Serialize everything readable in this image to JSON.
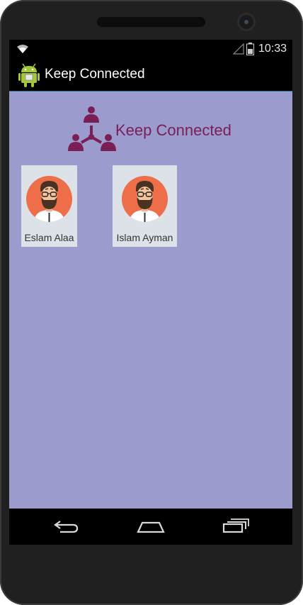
{
  "status_bar": {
    "time": "10:33"
  },
  "action_bar": {
    "title": "Keep Connected"
  },
  "header": {
    "logo_text": "Keep Connected"
  },
  "contacts": [
    {
      "name": "Eslam Alaa"
    },
    {
      "name": "Islam Ayman"
    }
  ],
  "colors": {
    "content_background": "#9b9bce",
    "accent": "#7a1f55",
    "avatar_circle": "#ee6e4a",
    "card_background": "#dde1e8"
  },
  "icons": {
    "app": "android-icon",
    "logo": "people-network-icon",
    "avatar": "man-avatar-icon",
    "back": "back-icon",
    "home": "home-icon",
    "recent": "recent-apps-icon"
  }
}
